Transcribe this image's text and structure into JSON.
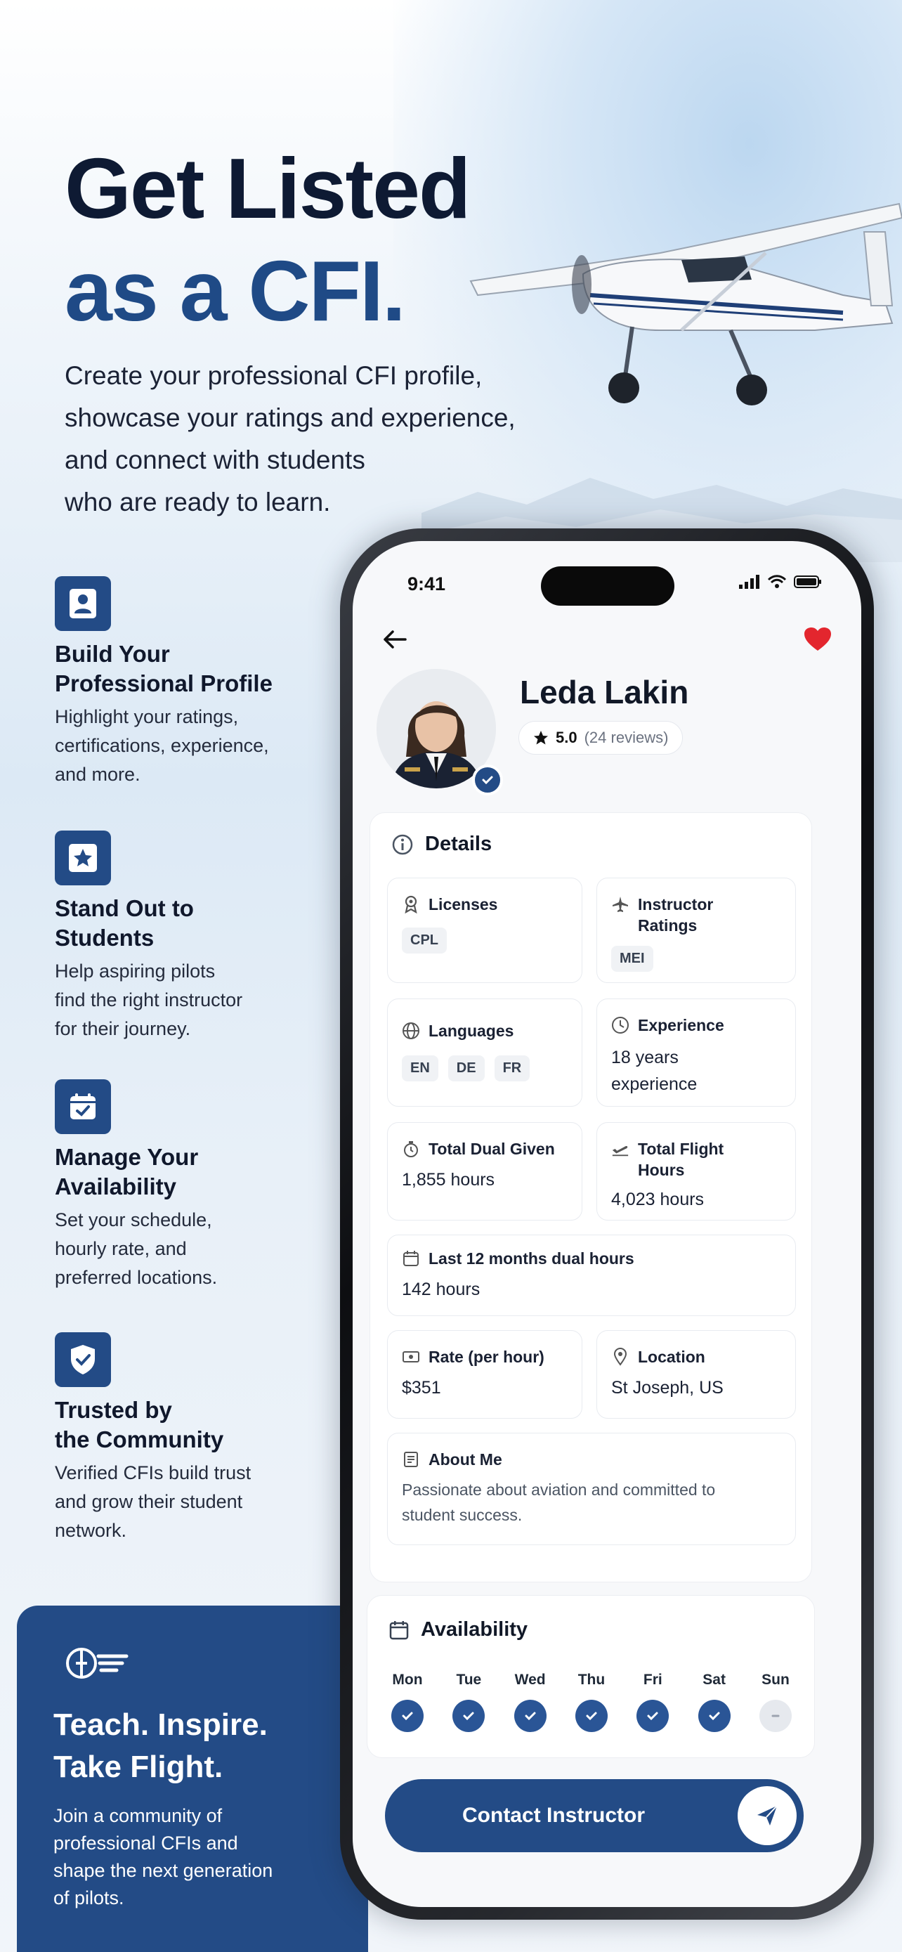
{
  "hero": {
    "title_line1": "Get Listed",
    "title_line2": "as a CFI.",
    "intro_lines": "Create your professional CFI profile,\nshowcase your ratings and experience,\nand connect with students\nwho are ready to learn."
  },
  "features": [
    {
      "icon": "person-icon",
      "title": "Build Your\nProfessional Profile",
      "desc": "Highlight your ratings,\ncertifications, experience,\nand more."
    },
    {
      "icon": "star-icon",
      "title": "Stand Out to\nStudents",
      "desc": "Help aspiring pilots\nfind the right instructor\nfor their journey."
    },
    {
      "icon": "calendar-check-icon",
      "title": "Manage Your\nAvailability",
      "desc": "Set your schedule,\nhourly rate, and\npreferred locations."
    },
    {
      "icon": "shield-check-icon",
      "title": "Trusted by\nthe Community",
      "desc": "Verified CFIs build trust\nand grow their student\nnetwork."
    }
  ],
  "promo": {
    "title": "Teach. Inspire.\nTake Flight.",
    "desc": "Join a community of\nprofessional CFIs and\nshape the next generation\nof pilots."
  },
  "phone": {
    "status_time": "9:41",
    "profile": {
      "name": "Leda Lakin",
      "rating": "5.0",
      "reviews": "(24 reviews)"
    },
    "details": {
      "heading": "Details",
      "licenses": {
        "label": "Licenses",
        "chips": [
          "CPL"
        ]
      },
      "instructor_ratings": {
        "label": "Instructor\nRatings",
        "chips": [
          "MEI"
        ]
      },
      "languages": {
        "label": "Languages",
        "chips": [
          "EN",
          "DE",
          "FR"
        ]
      },
      "experience": {
        "label": "Experience",
        "value": "18 years\nexperience"
      },
      "total_dual": {
        "label": "Total Dual Given",
        "value": "1,855 hours"
      },
      "total_flight": {
        "label": "Total Flight\nHours",
        "value": "4,023 hours"
      },
      "last12": {
        "label": "Last 12 months dual hours",
        "value": "142 hours"
      },
      "rate": {
        "label": "Rate (per hour)",
        "value": "$351"
      },
      "location": {
        "label": "Location",
        "value": "St Joseph, US"
      },
      "about": {
        "label": "About Me",
        "value": "Passionate about aviation and committed to student success."
      }
    },
    "availability": {
      "heading": "Availability",
      "days": [
        {
          "label": "Mon",
          "available": true
        },
        {
          "label": "Tue",
          "available": true
        },
        {
          "label": "Wed",
          "available": true
        },
        {
          "label": "Thu",
          "available": true
        },
        {
          "label": "Fri",
          "available": true
        },
        {
          "label": "Sat",
          "available": true
        },
        {
          "label": "Sun",
          "available": false
        }
      ]
    },
    "contact_label": "Contact Instructor"
  },
  "colors": {
    "brand_navy": "#234b86",
    "heart_red": "#e3262e",
    "text_dark": "#0e1a33"
  }
}
